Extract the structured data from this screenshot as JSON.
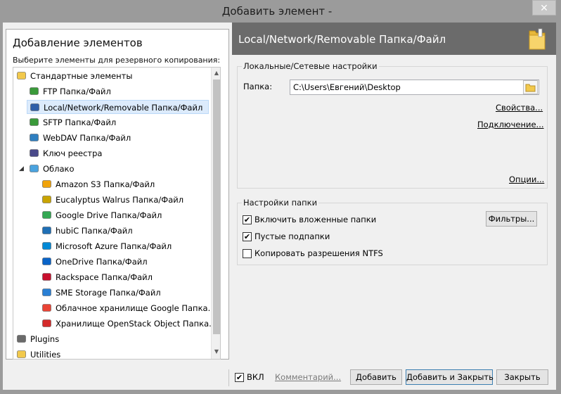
{
  "window": {
    "title": "Добавить элемент -",
    "close_glyph": "✕"
  },
  "left": {
    "title": "Добавление элементов",
    "subtitle": "Выберите элементы для резервного копирования:",
    "tree": [
      {
        "label": "Стандартные элементы",
        "icon": "folder-icon",
        "level": 0,
        "expander": "minus"
      },
      {
        "label": "FTP Папка/Файл",
        "icon": "ftp-icon",
        "level": 1
      },
      {
        "label": "Local/Network/Removable Папка/Файл",
        "icon": "computer-icon",
        "level": 1,
        "selected": true
      },
      {
        "label": "SFTP Папка/Файл",
        "icon": "sftp-icon",
        "level": 1
      },
      {
        "label": "WebDAV Папка/Файл",
        "icon": "webdav-icon",
        "level": 1
      },
      {
        "label": "Ключ реестра",
        "icon": "registry-icon",
        "level": 1
      },
      {
        "label": "Облако",
        "icon": "cloud-icon",
        "level": 1,
        "expander": "minus"
      },
      {
        "label": "Amazon S3 Папка/Файл",
        "icon": "amazon-s3-icon",
        "level": 2
      },
      {
        "label": "Eucalyptus Walrus Папка/Файл",
        "icon": "eucalyptus-icon",
        "level": 2
      },
      {
        "label": "Google Drive Папка/Файл",
        "icon": "google-drive-icon",
        "level": 2
      },
      {
        "label": "hubiC Папка/Файл",
        "icon": "hubic-icon",
        "level": 2
      },
      {
        "label": "Microsoft Azure Папка/Файл",
        "icon": "azure-icon",
        "level": 2
      },
      {
        "label": "OneDrive Папка/Файл",
        "icon": "onedrive-icon",
        "level": 2
      },
      {
        "label": "Rackspace Папка/Файл",
        "icon": "rackspace-icon",
        "level": 2
      },
      {
        "label": "SME Storage Папка/Файл",
        "icon": "sme-storage-icon",
        "level": 2
      },
      {
        "label": "Облачное хранилище Google Папка...",
        "icon": "google-cloud-icon",
        "level": 2
      },
      {
        "label": "Хранилище OpenStack Object Папка...",
        "icon": "openstack-icon",
        "level": 2
      },
      {
        "label": "Plugins",
        "icon": "plugins-icon",
        "level": 0
      },
      {
        "label": "Utilities",
        "icon": "utilities-icon",
        "level": 0,
        "expander": "plus"
      }
    ]
  },
  "right": {
    "header_title": "Local/Network/Removable Папка/Файл",
    "local_group": {
      "label": "Локальные/Сетевые настройки",
      "folder_label": "Папка:",
      "folder_value": "C:\\Users\\Евгений\\Desktop",
      "properties_link": "Свойства...",
      "connection_link": "Подключение...",
      "options_link": "Опции..."
    },
    "folder_group": {
      "label": "Настройки папки",
      "include_subfolders": "Включить вложенные папки",
      "empty_subfolders": "Пустые подпапки",
      "copy_ntfs": "Копировать разрешения NTFS",
      "filters_button": "Фильтры...",
      "checked": {
        "include_subfolders": true,
        "empty_subfolders": true,
        "copy_ntfs": false
      }
    }
  },
  "bottom": {
    "enabled_label": "ВКЛ",
    "enabled_checked": true,
    "comment_link": "Комментарий...",
    "add_button": "Добавить",
    "add_close_button": "Добавить и Закрыть",
    "close_button": "Закрыть"
  },
  "colors": {
    "header_bg": "#6b6b6b",
    "selection_bg": "#dcebfc",
    "primary_border": "#3c7fb1"
  }
}
